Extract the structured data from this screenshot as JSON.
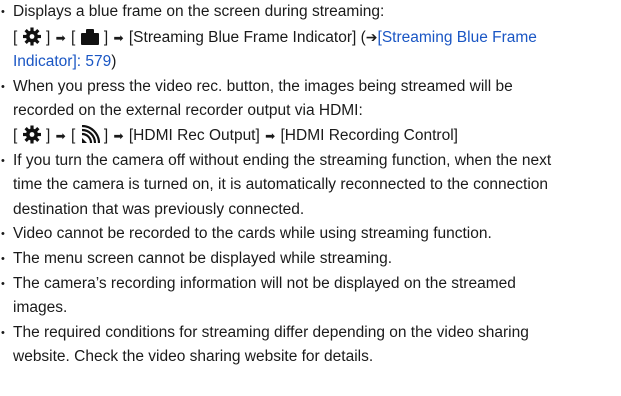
{
  "bullets": [
    {
      "text_line1": "Displays a blue frame on the screen during streaming:",
      "path": {
        "open": "[",
        "close": "]",
        "arrow": "➡",
        "icon1": "gear-icon",
        "icon2": "camera-icon",
        "menu_item": "[Streaming Blue Frame Indicator]",
        "ref_open": "(",
        "ref_arrow": "➔",
        "ref_link_part1": "[Streaming Blue Frame",
        "ref_link_part2": "Indicator]: 579",
        "ref_close": ")"
      }
    },
    {
      "text_line1": "When you press the video rec. button, the images being streamed will be",
      "text_line2": "recorded on the external recorder output via HDMI:",
      "path": {
        "open": "[",
        "close": "]",
        "arrow": "➡",
        "icon1": "gear-icon",
        "icon2": "video-signal-icon",
        "menu_item": "[HDMI Rec Output]",
        "menu_item2": "[HDMI Recording Control]"
      }
    },
    {
      "line1": "If you turn the camera off without ending the streaming function, when the next",
      "line2": "time the camera is turned on, it is automatically reconnected to the connection",
      "line3": "destination that was previously connected."
    },
    {
      "line1": "Video cannot be recorded to the cards while using streaming function."
    },
    {
      "line1": "The menu screen cannot be displayed while streaming."
    },
    {
      "line1": "The camera’s recording information will not be displayed on the streamed",
      "line2": "images."
    },
    {
      "line1": "The required conditions for streaming differ depending on the video sharing",
      "line2": "website. Check the video sharing website for details."
    }
  ],
  "bullet_char": "•",
  "colors": {
    "text": "#1a1a1a",
    "link": "#1a56c4"
  }
}
